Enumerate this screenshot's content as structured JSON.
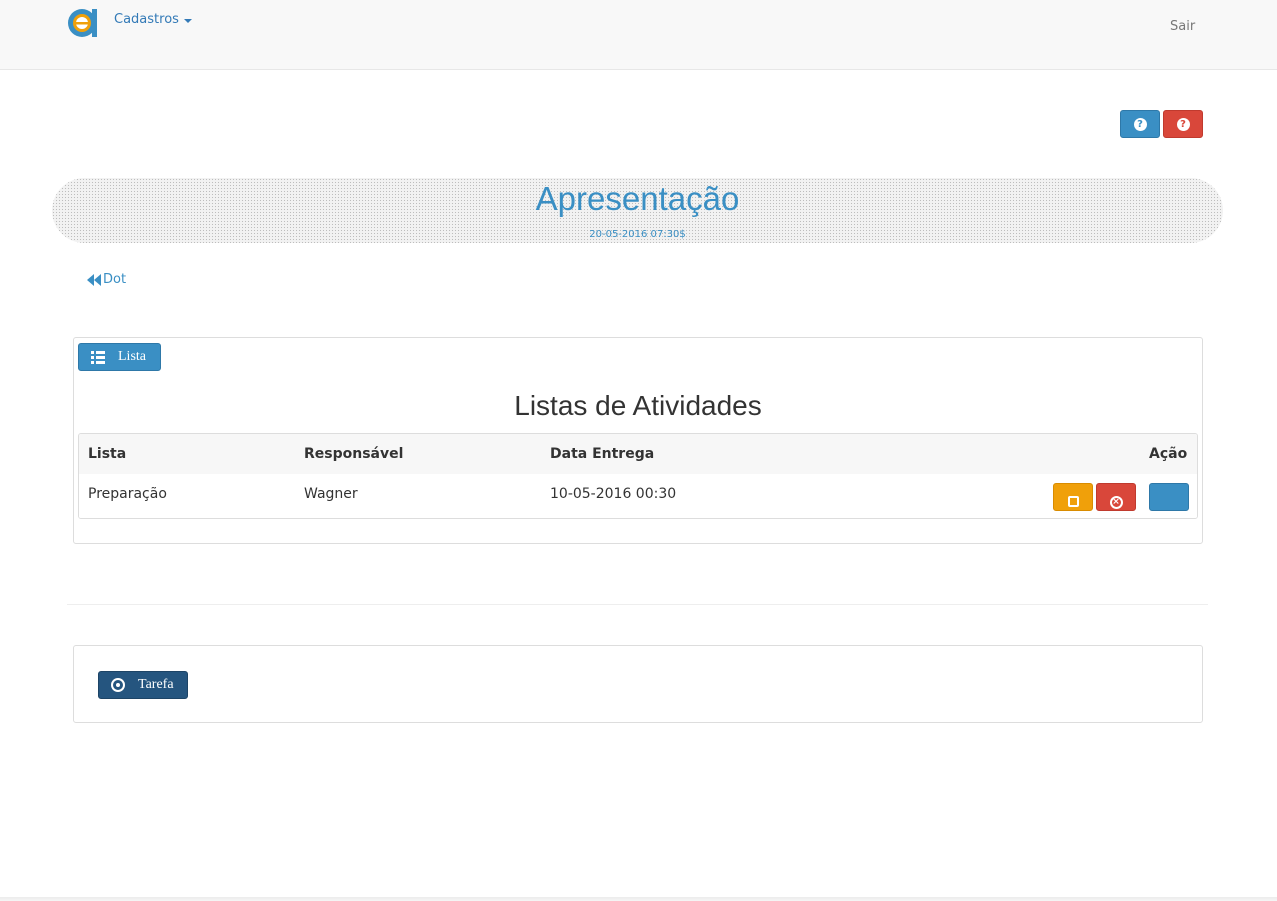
{
  "navbar": {
    "menu_label": "Cadastros",
    "logout_label": "Sair"
  },
  "help_buttons": [
    {
      "icon": "question-circle-icon",
      "color": "#3a8fc4"
    },
    {
      "icon": "question-circle-icon",
      "color": "#d9473a"
    }
  ],
  "banner": {
    "title": "Apresentação",
    "date": "20-05-2016 07:30$"
  },
  "back_link": {
    "label": "Dot"
  },
  "lists_panel": {
    "button_label": "Lista",
    "heading": "Listas de Atividades",
    "table": {
      "headers": [
        "Lista",
        "Responsável",
        "Data Entrega",
        "Ação"
      ],
      "rows": [
        {
          "lista": "Preparação",
          "responsavel": "Wagner",
          "data_entrega": "10-05-2016 00:30"
        }
      ]
    }
  },
  "task_panel": {
    "button_label": "Tarefa"
  },
  "colors": {
    "primary": "#3a8fc4",
    "danger": "#d9473a",
    "warning": "#f0a00a",
    "dark_primary": "#25557f"
  }
}
